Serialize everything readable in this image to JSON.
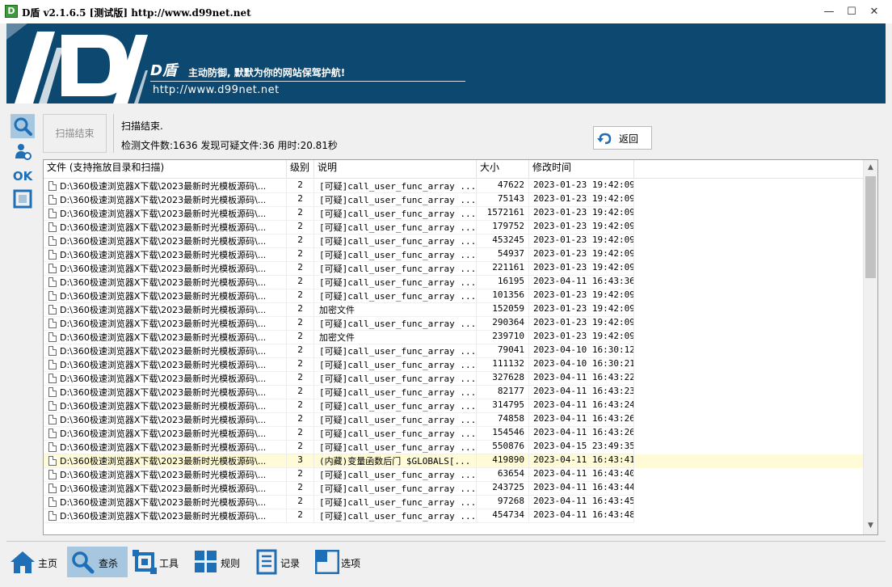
{
  "window": {
    "app_icon_letter": "D",
    "title": "D盾 v2.1.6.5 [测试版] http://www.d99net.net",
    "minimize": "—",
    "maximize": "☐",
    "close": "✕"
  },
  "banner": {
    "brand": "D盾",
    "slogan": "主动防御, 默默为你的网站保驾护航!",
    "url": "http://www.d99net.net",
    "colors": {
      "background": "#0d4870"
    }
  },
  "left_tools": [
    {
      "name": "search",
      "icon": "magnifier-icon",
      "active": true
    },
    {
      "name": "user",
      "icon": "user-gear-icon",
      "active": false
    },
    {
      "name": "ok",
      "icon": "ok-icon",
      "label": "OK",
      "active": false
    },
    {
      "name": "window",
      "icon": "frame-icon",
      "active": false
    }
  ],
  "scan": {
    "button_label": "扫描结束",
    "status": "扫描结束.",
    "stats": "检测文件数:1636 发现可疑文件:36 用时:20.81秒",
    "back_label": "返回"
  },
  "table": {
    "columns": [
      "文件 (支持拖放目录和扫描)",
      "级别",
      "说明",
      "大小",
      "修改时间"
    ],
    "rows": [
      {
        "file": "D:\\360极速浏览器X下载\\2023最新时光模板源码\\...",
        "level": "2",
        "desc": "[可疑]call_user_func_array ...",
        "size": "47622",
        "time": "2023-01-23 19:42:09"
      },
      {
        "file": "D:\\360极速浏览器X下载\\2023最新时光模板源码\\...",
        "level": "2",
        "desc": "[可疑]call_user_func_array ...",
        "size": "75143",
        "time": "2023-01-23 19:42:09"
      },
      {
        "file": "D:\\360极速浏览器X下载\\2023最新时光模板源码\\...",
        "level": "2",
        "desc": "[可疑]call_user_func_array ...",
        "size": "1572161",
        "time": "2023-01-23 19:42:09"
      },
      {
        "file": "D:\\360极速浏览器X下载\\2023最新时光模板源码\\...",
        "level": "2",
        "desc": "[可疑]call_user_func_array ...",
        "size": "179752",
        "time": "2023-01-23 19:42:09"
      },
      {
        "file": "D:\\360极速浏览器X下载\\2023最新时光模板源码\\...",
        "level": "2",
        "desc": "[可疑]call_user_func_array ...",
        "size": "453245",
        "time": "2023-01-23 19:42:09"
      },
      {
        "file": "D:\\360极速浏览器X下载\\2023最新时光模板源码\\...",
        "level": "2",
        "desc": "[可疑]call_user_func_array ...",
        "size": "54937",
        "time": "2023-01-23 19:42:09"
      },
      {
        "file": "D:\\360极速浏览器X下载\\2023最新时光模板源码\\...",
        "level": "2",
        "desc": "[可疑]call_user_func_array ...",
        "size": "221161",
        "time": "2023-01-23 19:42:09"
      },
      {
        "file": "D:\\360极速浏览器X下载\\2023最新时光模板源码\\...",
        "level": "2",
        "desc": "[可疑]call_user_func_array ...",
        "size": "16195",
        "time": "2023-04-11 16:43:36"
      },
      {
        "file": "D:\\360极速浏览器X下载\\2023最新时光模板源码\\...",
        "level": "2",
        "desc": "[可疑]call_user_func_array ...",
        "size": "101356",
        "time": "2023-01-23 19:42:09"
      },
      {
        "file": "D:\\360极速浏览器X下载\\2023最新时光模板源码\\...",
        "level": "2",
        "desc": "加密文件",
        "size": "152059",
        "time": "2023-01-23 19:42:09"
      },
      {
        "file": "D:\\360极速浏览器X下载\\2023最新时光模板源码\\...",
        "level": "2",
        "desc": "[可疑]call_user_func_array ...",
        "size": "290364",
        "time": "2023-01-23 19:42:09"
      },
      {
        "file": "D:\\360极速浏览器X下载\\2023最新时光模板源码\\...",
        "level": "2",
        "desc": "加密文件",
        "size": "239710",
        "time": "2023-01-23 19:42:09"
      },
      {
        "file": "D:\\360极速浏览器X下载\\2023最新时光模板源码\\...",
        "level": "2",
        "desc": "[可疑]call_user_func_array ...",
        "size": "79041",
        "time": "2023-04-10 16:30:12"
      },
      {
        "file": "D:\\360极速浏览器X下载\\2023最新时光模板源码\\...",
        "level": "2",
        "desc": "[可疑]call_user_func_array ...",
        "size": "111132",
        "time": "2023-04-10 16:30:21"
      },
      {
        "file": "D:\\360极速浏览器X下载\\2023最新时光模板源码\\...",
        "level": "2",
        "desc": "[可疑]call_user_func_array ...",
        "size": "327628",
        "time": "2023-04-11 16:43:22"
      },
      {
        "file": "D:\\360极速浏览器X下载\\2023最新时光模板源码\\...",
        "level": "2",
        "desc": "[可疑]call_user_func_array ...",
        "size": "82177",
        "time": "2023-04-11 16:43:23"
      },
      {
        "file": "D:\\360极速浏览器X下载\\2023最新时光模板源码\\...",
        "level": "2",
        "desc": "[可疑]call_user_func_array ...",
        "size": "314795",
        "time": "2023-04-11 16:43:24"
      },
      {
        "file": "D:\\360极速浏览器X下载\\2023最新时光模板源码\\...",
        "level": "2",
        "desc": "[可疑]call_user_func_array ...",
        "size": "74858",
        "time": "2023-04-11 16:43:26"
      },
      {
        "file": "D:\\360极速浏览器X下载\\2023最新时光模板源码\\...",
        "level": "2",
        "desc": "[可疑]call_user_func_array ...",
        "size": "154546",
        "time": "2023-04-11 16:43:26"
      },
      {
        "file": "D:\\360极速浏览器X下载\\2023最新时光模板源码\\...",
        "level": "2",
        "desc": "[可疑]call_user_func_array ...",
        "size": "550876",
        "time": "2023-04-15 23:49:35"
      },
      {
        "file": "D:\\360极速浏览器X下载\\2023最新时光模板源码\\...",
        "level": "3",
        "desc": "(内藏)变量函数后门 $GLOBALS[...",
        "size": "419890",
        "time": "2023-04-11 16:43:41",
        "highlight": true
      },
      {
        "file": "D:\\360极速浏览器X下载\\2023最新时光模板源码\\...",
        "level": "2",
        "desc": "[可疑]call_user_func_array ...",
        "size": "63654",
        "time": "2023-04-11 16:43:40"
      },
      {
        "file": "D:\\360极速浏览器X下载\\2023最新时光模板源码\\...",
        "level": "2",
        "desc": "[可疑]call_user_func_array ...",
        "size": "243725",
        "time": "2023-04-11 16:43:44"
      },
      {
        "file": "D:\\360极速浏览器X下载\\2023最新时光模板源码\\...",
        "level": "2",
        "desc": "[可疑]call_user_func_array ...",
        "size": "97268",
        "time": "2023-04-11 16:43:45"
      },
      {
        "file": "D:\\360极速浏览器X下载\\2023最新时光模板源码\\...",
        "level": "2",
        "desc": "[可疑]call_user_func_array ...",
        "size": "454734",
        "time": "2023-04-11 16:43:48"
      }
    ],
    "scroll_up": "▲",
    "scroll_down": "▼"
  },
  "bottom_nav": [
    {
      "label": "主页",
      "icon": "home-icon",
      "active": false
    },
    {
      "label": "查杀",
      "icon": "search-icon",
      "active": true
    },
    {
      "label": "工具",
      "icon": "tools-icon",
      "active": false
    },
    {
      "label": "规则",
      "icon": "rules-icon",
      "active": false
    },
    {
      "label": "记录",
      "icon": "log-icon",
      "active": false
    },
    {
      "label": "选项",
      "icon": "options-icon",
      "active": false
    }
  ],
  "colors": {
    "accent": "#1e6fb5",
    "active_bg": "#a7c7e0",
    "highlight_row": "#fffbd6"
  }
}
